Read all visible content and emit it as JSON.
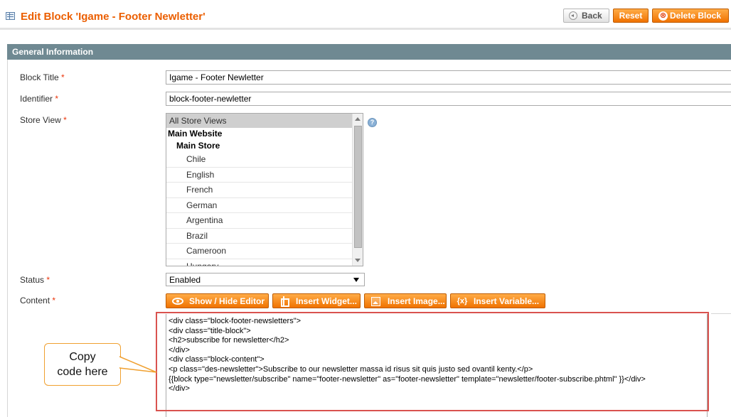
{
  "header": {
    "title": "Edit Block 'Igame - Footer Newletter'",
    "back_label": "Back",
    "reset_label": "Reset",
    "delete_label": "Delete Block",
    "delete_icon": "⊗",
    "help_icon": "?"
  },
  "section": {
    "title": "General Information"
  },
  "required_mark": "*",
  "form": {
    "block_title": {
      "label": "Block Title",
      "value": "Igame - Footer Newletter"
    },
    "identifier": {
      "label": "Identifier",
      "value": "block-footer-newletter"
    },
    "store_view": {
      "label": "Store View",
      "options": [
        {
          "label": "All Store Views",
          "kind": "selected"
        },
        {
          "label": "Main Website",
          "kind": "group1"
        },
        {
          "label": "Main Store",
          "kind": "group2"
        },
        {
          "label": "Chile",
          "kind": "opt"
        },
        {
          "label": "English",
          "kind": "opt"
        },
        {
          "label": "French",
          "kind": "opt"
        },
        {
          "label": "German",
          "kind": "opt"
        },
        {
          "label": "Argentina",
          "kind": "opt"
        },
        {
          "label": "Brazil",
          "kind": "opt"
        },
        {
          "label": "Cameroon",
          "kind": "opt"
        },
        {
          "label": "Hungary",
          "kind": "opt"
        }
      ]
    },
    "status": {
      "label": "Status",
      "value": "Enabled"
    },
    "content": {
      "label": "Content",
      "buttons": {
        "show_hide": "Show / Hide Editor",
        "widget": "Insert Widget...",
        "image": "Insert Image...",
        "variable": "Insert Variable..."
      },
      "variable_icon": "{x}",
      "code": "<div class=\"block-footer-newsletters\">\n<div class=\"title-block\">\n<h2>subscribe for newsletter</h2>\n</div>\n<div class=\"block-content\">\n<p class=\"des-newsletter\">Subscribe to our newsletter massa id risus sit quis justo sed ovantil kenty.</p>\n{{block type=\"newsletter/subscribe\" name=\"footer-newsletter\" as=\"footer-newsletter\" template=\"newsletter/footer-subscribe.phtml\" }}</div>\n</div>"
    }
  },
  "callout": {
    "line1": "Copy",
    "line2": "code here"
  },
  "colors": {
    "title_orange": "#eb5e00",
    "button_orange": "#f07200",
    "section_bar": "#6f8992",
    "highlight_red": "#d9534f",
    "callout_border": "#f0a030"
  }
}
